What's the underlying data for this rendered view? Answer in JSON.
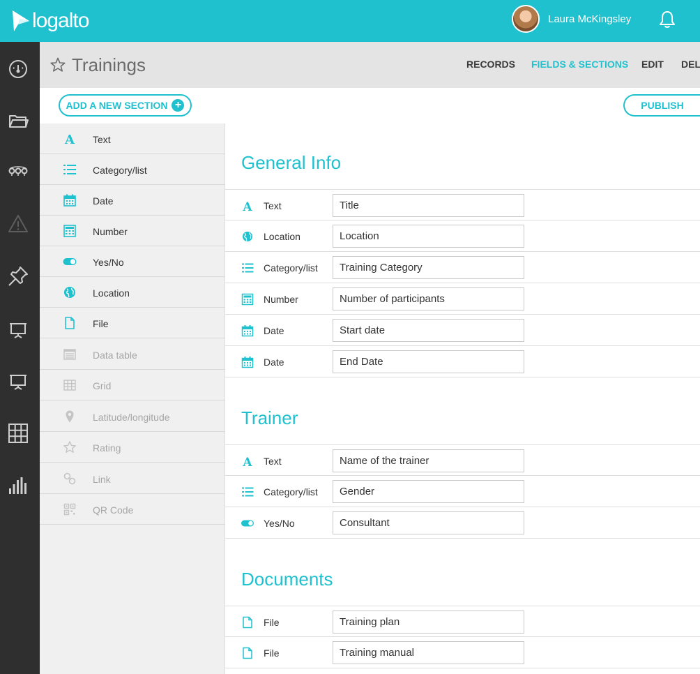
{
  "app": {
    "logo_text": "logalto",
    "user_name": "Laura McKingsley"
  },
  "colors": {
    "accent": "#20c1cf",
    "rail": "#2f2f2f"
  },
  "header": {
    "title": "Trainings",
    "nav": [
      {
        "label": "RECORDS"
      },
      {
        "label": "FIELDS & SECTIONS"
      },
      {
        "label": "EDIT"
      },
      {
        "label": "DEL"
      }
    ]
  },
  "actions": {
    "add_section_label": "ADD A NEW SECTION",
    "publish_label": "PUBLISH"
  },
  "rail": {
    "items": [
      {
        "icon": "dashboard-icon"
      },
      {
        "icon": "folder-icon"
      },
      {
        "icon": "workflow-icon"
      },
      {
        "icon": "warning-icon"
      },
      {
        "icon": "pin-icon"
      },
      {
        "icon": "presentation-icon"
      },
      {
        "icon": "presentation-icon"
      },
      {
        "icon": "grid-icon"
      },
      {
        "icon": "bar-chart-icon"
      }
    ]
  },
  "palette": {
    "items": [
      {
        "label": "Text",
        "icon": "text-icon",
        "enabled": true
      },
      {
        "label": "Category/list",
        "icon": "list-icon",
        "enabled": true
      },
      {
        "label": "Date",
        "icon": "calendar-icon",
        "enabled": true
      },
      {
        "label": "Number",
        "icon": "calculator-icon",
        "enabled": true
      },
      {
        "label": "Yes/No",
        "icon": "toggle-icon",
        "enabled": true
      },
      {
        "label": "Location",
        "icon": "globe-icon",
        "enabled": true
      },
      {
        "label": "File",
        "icon": "file-icon",
        "enabled": true
      },
      {
        "label": "Data table",
        "icon": "data-table-icon",
        "enabled": false
      },
      {
        "label": "Grid",
        "icon": "grid-icon",
        "enabled": false
      },
      {
        "label": "Latitude/longitude",
        "icon": "map-pin-icon",
        "enabled": false
      },
      {
        "label": "Rating",
        "icon": "star-icon",
        "enabled": false
      },
      {
        "label": "Link",
        "icon": "link-icon",
        "enabled": false
      },
      {
        "label": "QR Code",
        "icon": "qr-code-icon",
        "enabled": false
      }
    ]
  },
  "sections": [
    {
      "title": "General Info",
      "fields": [
        {
          "type": "Text",
          "icon": "text-icon",
          "value": "Title"
        },
        {
          "type": "Location",
          "icon": "globe-icon",
          "value": "Location"
        },
        {
          "type": "Category/list",
          "icon": "list-icon",
          "value": "Training Category"
        },
        {
          "type": "Number",
          "icon": "calculator-icon",
          "value": "Number of participants"
        },
        {
          "type": "Date",
          "icon": "calendar-icon",
          "value": "Start date"
        },
        {
          "type": "Date",
          "icon": "calendar-icon",
          "value": "End Date"
        }
      ]
    },
    {
      "title": "Trainer",
      "fields": [
        {
          "type": "Text",
          "icon": "text-icon",
          "value": "Name of the trainer"
        },
        {
          "type": "Category/list",
          "icon": "list-icon",
          "value": "Gender"
        },
        {
          "type": "Yes/No",
          "icon": "toggle-icon",
          "value": "Consultant"
        }
      ]
    },
    {
      "title": "Documents",
      "fields": [
        {
          "type": "File",
          "icon": "file-icon",
          "value": "Training plan"
        },
        {
          "type": "File",
          "icon": "file-icon",
          "value": "Training manual"
        }
      ]
    }
  ]
}
